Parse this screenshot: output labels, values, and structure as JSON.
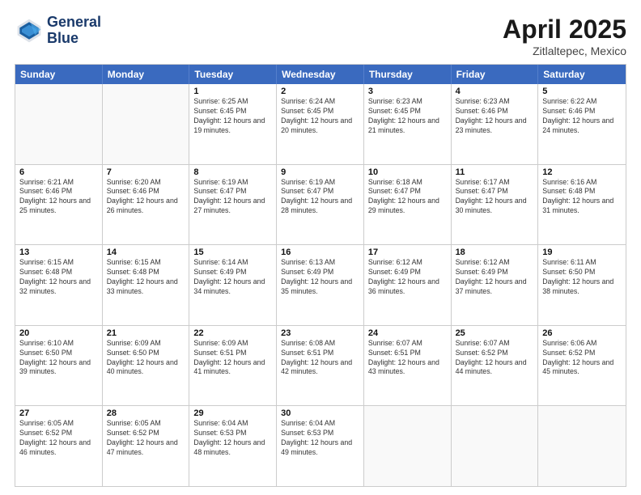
{
  "logo": {
    "line1": "General",
    "line2": "Blue"
  },
  "title": {
    "month_year": "April 2025",
    "location": "Zitlaltepec, Mexico"
  },
  "days_of_week": [
    "Sunday",
    "Monday",
    "Tuesday",
    "Wednesday",
    "Thursday",
    "Friday",
    "Saturday"
  ],
  "rows": [
    [
      {
        "day": "",
        "sunrise": "",
        "sunset": "",
        "daylight": ""
      },
      {
        "day": "",
        "sunrise": "",
        "sunset": "",
        "daylight": ""
      },
      {
        "day": "1",
        "sunrise": "Sunrise: 6:25 AM",
        "sunset": "Sunset: 6:45 PM",
        "daylight": "Daylight: 12 hours and 19 minutes."
      },
      {
        "day": "2",
        "sunrise": "Sunrise: 6:24 AM",
        "sunset": "Sunset: 6:45 PM",
        "daylight": "Daylight: 12 hours and 20 minutes."
      },
      {
        "day": "3",
        "sunrise": "Sunrise: 6:23 AM",
        "sunset": "Sunset: 6:45 PM",
        "daylight": "Daylight: 12 hours and 21 minutes."
      },
      {
        "day": "4",
        "sunrise": "Sunrise: 6:23 AM",
        "sunset": "Sunset: 6:46 PM",
        "daylight": "Daylight: 12 hours and 23 minutes."
      },
      {
        "day": "5",
        "sunrise": "Sunrise: 6:22 AM",
        "sunset": "Sunset: 6:46 PM",
        "daylight": "Daylight: 12 hours and 24 minutes."
      }
    ],
    [
      {
        "day": "6",
        "sunrise": "Sunrise: 6:21 AM",
        "sunset": "Sunset: 6:46 PM",
        "daylight": "Daylight: 12 hours and 25 minutes."
      },
      {
        "day": "7",
        "sunrise": "Sunrise: 6:20 AM",
        "sunset": "Sunset: 6:46 PM",
        "daylight": "Daylight: 12 hours and 26 minutes."
      },
      {
        "day": "8",
        "sunrise": "Sunrise: 6:19 AM",
        "sunset": "Sunset: 6:47 PM",
        "daylight": "Daylight: 12 hours and 27 minutes."
      },
      {
        "day": "9",
        "sunrise": "Sunrise: 6:19 AM",
        "sunset": "Sunset: 6:47 PM",
        "daylight": "Daylight: 12 hours and 28 minutes."
      },
      {
        "day": "10",
        "sunrise": "Sunrise: 6:18 AM",
        "sunset": "Sunset: 6:47 PM",
        "daylight": "Daylight: 12 hours and 29 minutes."
      },
      {
        "day": "11",
        "sunrise": "Sunrise: 6:17 AM",
        "sunset": "Sunset: 6:47 PM",
        "daylight": "Daylight: 12 hours and 30 minutes."
      },
      {
        "day": "12",
        "sunrise": "Sunrise: 6:16 AM",
        "sunset": "Sunset: 6:48 PM",
        "daylight": "Daylight: 12 hours and 31 minutes."
      }
    ],
    [
      {
        "day": "13",
        "sunrise": "Sunrise: 6:15 AM",
        "sunset": "Sunset: 6:48 PM",
        "daylight": "Daylight: 12 hours and 32 minutes."
      },
      {
        "day": "14",
        "sunrise": "Sunrise: 6:15 AM",
        "sunset": "Sunset: 6:48 PM",
        "daylight": "Daylight: 12 hours and 33 minutes."
      },
      {
        "day": "15",
        "sunrise": "Sunrise: 6:14 AM",
        "sunset": "Sunset: 6:49 PM",
        "daylight": "Daylight: 12 hours and 34 minutes."
      },
      {
        "day": "16",
        "sunrise": "Sunrise: 6:13 AM",
        "sunset": "Sunset: 6:49 PM",
        "daylight": "Daylight: 12 hours and 35 minutes."
      },
      {
        "day": "17",
        "sunrise": "Sunrise: 6:12 AM",
        "sunset": "Sunset: 6:49 PM",
        "daylight": "Daylight: 12 hours and 36 minutes."
      },
      {
        "day": "18",
        "sunrise": "Sunrise: 6:12 AM",
        "sunset": "Sunset: 6:49 PM",
        "daylight": "Daylight: 12 hours and 37 minutes."
      },
      {
        "day": "19",
        "sunrise": "Sunrise: 6:11 AM",
        "sunset": "Sunset: 6:50 PM",
        "daylight": "Daylight: 12 hours and 38 minutes."
      }
    ],
    [
      {
        "day": "20",
        "sunrise": "Sunrise: 6:10 AM",
        "sunset": "Sunset: 6:50 PM",
        "daylight": "Daylight: 12 hours and 39 minutes."
      },
      {
        "day": "21",
        "sunrise": "Sunrise: 6:09 AM",
        "sunset": "Sunset: 6:50 PM",
        "daylight": "Daylight: 12 hours and 40 minutes."
      },
      {
        "day": "22",
        "sunrise": "Sunrise: 6:09 AM",
        "sunset": "Sunset: 6:51 PM",
        "daylight": "Daylight: 12 hours and 41 minutes."
      },
      {
        "day": "23",
        "sunrise": "Sunrise: 6:08 AM",
        "sunset": "Sunset: 6:51 PM",
        "daylight": "Daylight: 12 hours and 42 minutes."
      },
      {
        "day": "24",
        "sunrise": "Sunrise: 6:07 AM",
        "sunset": "Sunset: 6:51 PM",
        "daylight": "Daylight: 12 hours and 43 minutes."
      },
      {
        "day": "25",
        "sunrise": "Sunrise: 6:07 AM",
        "sunset": "Sunset: 6:52 PM",
        "daylight": "Daylight: 12 hours and 44 minutes."
      },
      {
        "day": "26",
        "sunrise": "Sunrise: 6:06 AM",
        "sunset": "Sunset: 6:52 PM",
        "daylight": "Daylight: 12 hours and 45 minutes."
      }
    ],
    [
      {
        "day": "27",
        "sunrise": "Sunrise: 6:05 AM",
        "sunset": "Sunset: 6:52 PM",
        "daylight": "Daylight: 12 hours and 46 minutes."
      },
      {
        "day": "28",
        "sunrise": "Sunrise: 6:05 AM",
        "sunset": "Sunset: 6:52 PM",
        "daylight": "Daylight: 12 hours and 47 minutes."
      },
      {
        "day": "29",
        "sunrise": "Sunrise: 6:04 AM",
        "sunset": "Sunset: 6:53 PM",
        "daylight": "Daylight: 12 hours and 48 minutes."
      },
      {
        "day": "30",
        "sunrise": "Sunrise: 6:04 AM",
        "sunset": "Sunset: 6:53 PM",
        "daylight": "Daylight: 12 hours and 49 minutes."
      },
      {
        "day": "",
        "sunrise": "",
        "sunset": "",
        "daylight": ""
      },
      {
        "day": "",
        "sunrise": "",
        "sunset": "",
        "daylight": ""
      },
      {
        "day": "",
        "sunrise": "",
        "sunset": "",
        "daylight": ""
      }
    ]
  ]
}
